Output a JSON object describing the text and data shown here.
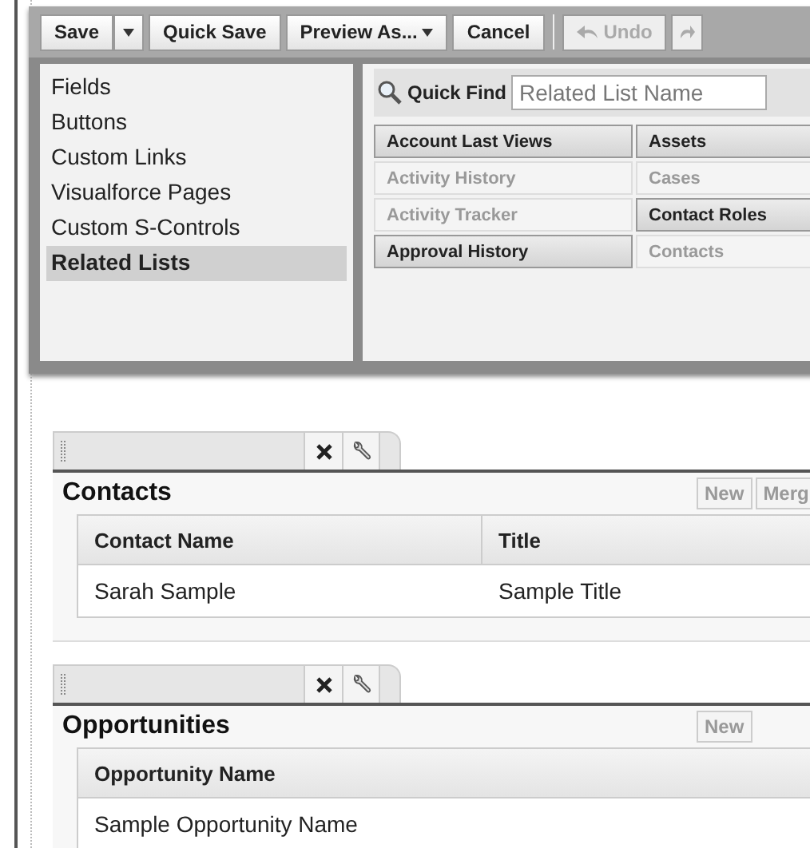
{
  "toolbar": {
    "buttons": [
      {
        "label": "Save",
        "kind": "split",
        "disabled": false
      },
      {
        "label": "Quick Save",
        "kind": "plain",
        "disabled": false
      },
      {
        "label": "Preview As...",
        "kind": "dropdown",
        "disabled": false
      },
      {
        "label": "Cancel",
        "kind": "plain",
        "disabled": false
      },
      {
        "label": "Undo",
        "kind": "undo",
        "disabled": true
      },
      {
        "kind": "redo",
        "disabled": true
      }
    ]
  },
  "sidebar": {
    "items": [
      {
        "label": "Fields",
        "selected": false
      },
      {
        "label": "Buttons",
        "selected": false
      },
      {
        "label": "Custom Links",
        "selected": false
      },
      {
        "label": "Visualforce Pages",
        "selected": false
      },
      {
        "label": "Custom S-Controls",
        "selected": false
      },
      {
        "label": "Related Lists",
        "selected": true
      }
    ]
  },
  "quick_find": {
    "label": "Quick Find",
    "placeholder": "Related List Name"
  },
  "related_lists": [
    {
      "label": "Account Last Views",
      "disabled": false
    },
    {
      "label": "Assets",
      "disabled": false
    },
    {
      "label": "Activity History",
      "disabled": true
    },
    {
      "label": "Cases",
      "disabled": true
    },
    {
      "label": "Activity Tracker",
      "disabled": true
    },
    {
      "label": "Contact Roles",
      "disabled": false
    },
    {
      "label": "Approval History",
      "disabled": false
    },
    {
      "label": "Contacts",
      "disabled": true
    }
  ],
  "sections": [
    {
      "title": "Contacts",
      "buttons": [
        "New",
        "Merg"
      ],
      "columns": [
        "Contact Name",
        "Title"
      ],
      "rows": [
        [
          "Sarah Sample",
          "Sample Title"
        ]
      ]
    },
    {
      "title": "Opportunities",
      "buttons": [
        "New"
      ],
      "columns": [
        "Opportunity Name"
      ],
      "rows": [
        [
          "Sample Opportunity Name"
        ]
      ]
    }
  ]
}
